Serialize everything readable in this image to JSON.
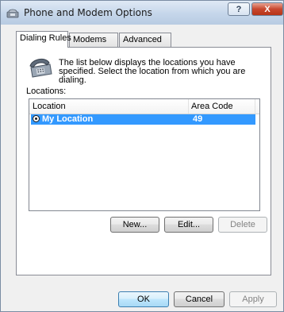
{
  "window": {
    "title": "Phone and Modem Options"
  },
  "tabs": [
    {
      "label": "Dialing Rules"
    },
    {
      "label": "Modems"
    },
    {
      "label": "Advanced"
    }
  ],
  "panel": {
    "description": "The list below displays the locations you have specified. Select the location from which you are dialing.",
    "locations_label": "Locations:",
    "columns": [
      "Location",
      "Area Code"
    ],
    "rows": [
      {
        "location": "My Location",
        "area_code": "49",
        "selected": true
      }
    ],
    "buttons": {
      "new": "New...",
      "edit": "Edit...",
      "delete": "Delete"
    }
  },
  "footer": {
    "ok": "OK",
    "cancel": "Cancel",
    "apply": "Apply"
  },
  "titlebar_buttons": {
    "help": "?",
    "close": "X"
  },
  "colors": {
    "selection": "#3399ff",
    "close_button": "#c8472e"
  }
}
